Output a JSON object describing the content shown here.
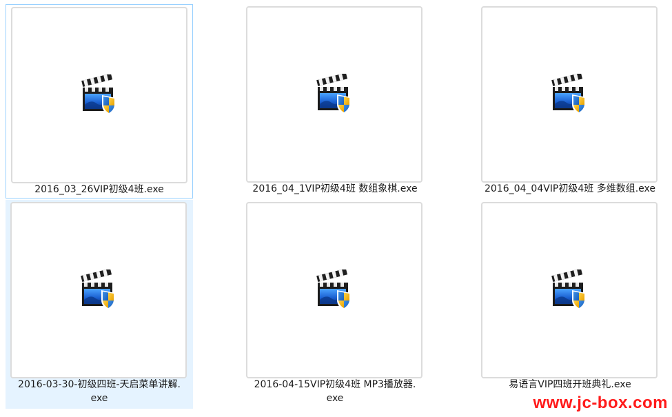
{
  "files": [
    {
      "name": "2016_03_26VIP初级4班.exe",
      "icon": "video-exe-shield-icon",
      "state": "focused"
    },
    {
      "name": "2016_04_1VIP初级4班 数组象棋.exe",
      "icon": "video-exe-shield-icon",
      "state": "normal"
    },
    {
      "name": "2016_04_04VIP初级4班 多维数组.exe",
      "icon": "video-exe-shield-icon",
      "state": "normal"
    },
    {
      "name": "2016-03-30-初级四班-天启菜单讲解.\nexe",
      "icon": "video-exe-shield-icon",
      "state": "hovered"
    },
    {
      "name": "2016-04-15VIP初级4班 MP3播放器.\nexe",
      "icon": "video-exe-shield-icon",
      "state": "normal"
    },
    {
      "name": "易语言VIP四班开班典礼.exe",
      "icon": "video-exe-shield-icon",
      "state": "normal"
    }
  ],
  "watermark": "www.jc-box.com",
  "colors": {
    "hover_bg": "#e5f3ff",
    "focus_border": "#99d1ff",
    "watermark": "#ff1a1a"
  }
}
